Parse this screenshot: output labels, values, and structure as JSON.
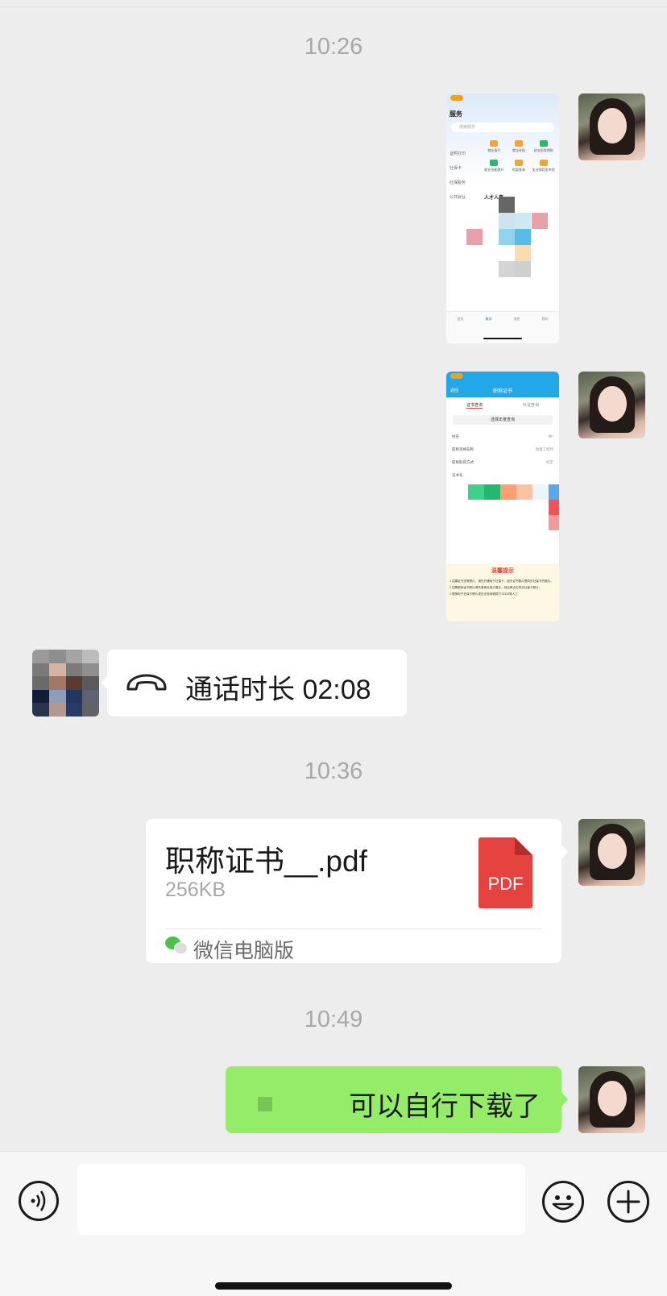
{
  "timestamps": [
    "10:26",
    "10:36",
    "10:49"
  ],
  "call": {
    "text": "通话时长 02:08",
    "icon": "phone-hangup-icon"
  },
  "file": {
    "name": "职称证书__.pdf",
    "size": "256KB",
    "badge": "PDF",
    "source": "微信电脑版",
    "badge_color": "#e64340"
  },
  "message_sent": {
    "text": "可以自行下载了"
  },
  "shot1": {
    "title": "服务",
    "search_placeholder": "搜索服务",
    "side": [
      "证照打印",
      "社保卡",
      "社保服务",
      "公共就业"
    ],
    "grid": [
      "就业指引",
      "就业补贴",
      "创业担保贷款",
      "职业技能提升",
      "档案查询",
      "失业保险金申领"
    ],
    "section": "人才人事",
    "tabs": [
      "首页",
      "服务",
      "消息",
      "我的"
    ]
  },
  "shot2": {
    "header": "职称证书",
    "back": "返回",
    "tabs": [
      "证书查询",
      "补证查询"
    ],
    "button": "选择年度查询",
    "rows": [
      {
        "label": "姓名",
        "value": "林*"
      },
      {
        "label": "职称资格名称",
        "value": "助理工程师"
      },
      {
        "label": "职称取得方式",
        "value": "初定"
      },
      {
        "label": "证书号",
        "value": ""
      }
    ],
    "tip_title": "温馨提示",
    "tips": [
      "1.如果证书没有照片，请先开通电子社保卡，因为证书照片是同步社保卡的照片。",
      "2.如需更换证书照片请先更换社保卡照片，然后再点击同步社保卡照片。",
      "3.更换电子社保卡照片或无法查询请拨打12333转人工"
    ]
  },
  "colors": {
    "background": "#ededed",
    "green_bubble": "#95ec69",
    "time_text": "#a8a8a8"
  }
}
